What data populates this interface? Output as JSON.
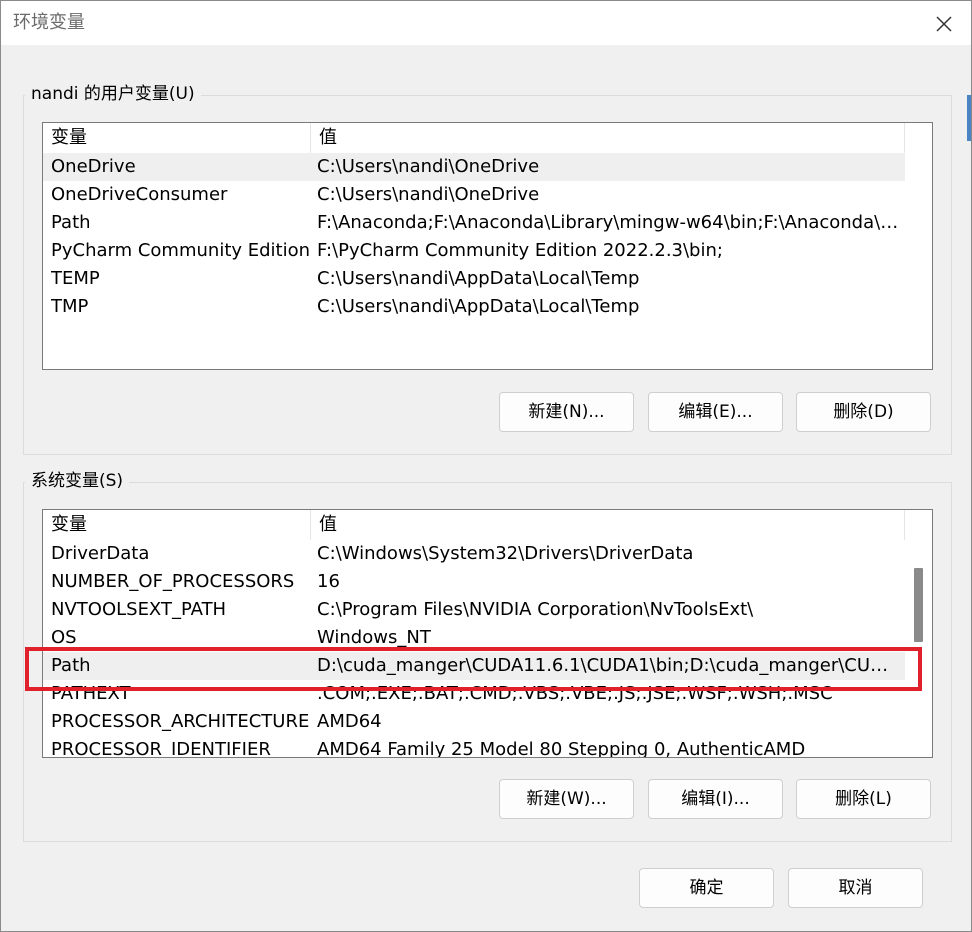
{
  "window": {
    "title": "环境变量",
    "close_glyph": "✕"
  },
  "user_vars": {
    "group_label": "nandi 的用户变量(U)",
    "col_variable": "变量",
    "col_value": "值",
    "rows": [
      {
        "name": "OneDrive",
        "value": "C:\\Users\\nandi\\OneDrive",
        "selected": true
      },
      {
        "name": "OneDriveConsumer",
        "value": "C:\\Users\\nandi\\OneDrive",
        "selected": false
      },
      {
        "name": "Path",
        "value": "F:\\Anaconda;F:\\Anaconda\\Library\\mingw-w64\\bin;F:\\Anaconda\\Li...",
        "selected": false
      },
      {
        "name": "PyCharm Community Edition",
        "value": "F:\\PyCharm Community Edition 2022.2.3\\bin;",
        "selected": false
      },
      {
        "name": "TEMP",
        "value": "C:\\Users\\nandi\\AppData\\Local\\Temp",
        "selected": false
      },
      {
        "name": "TMP",
        "value": "C:\\Users\\nandi\\AppData\\Local\\Temp",
        "selected": false
      }
    ],
    "buttons": {
      "new": "新建(N)...",
      "edit": "编辑(E)...",
      "delete": "删除(D)"
    }
  },
  "system_vars": {
    "group_label": "系统变量(S)",
    "col_variable": "变量",
    "col_value": "值",
    "rows": [
      {
        "name": "DriverData",
        "value": "C:\\Windows\\System32\\Drivers\\DriverData",
        "selected": false
      },
      {
        "name": "NUMBER_OF_PROCESSORS",
        "value": "16",
        "selected": false
      },
      {
        "name": "NVTOOLSEXT_PATH",
        "value": "C:\\Program Files\\NVIDIA Corporation\\NvToolsExt\\",
        "selected": false
      },
      {
        "name": "OS",
        "value": "Windows_NT",
        "selected": false
      },
      {
        "name": "Path",
        "value": "D:\\cuda_manger\\CUDA11.6.1\\CUDA1\\bin;D:\\cuda_manger\\CUDA...",
        "selected": true
      },
      {
        "name": "PATHEXT",
        "value": ".COM;.EXE;.BAT;.CMD;.VBS;.VBE;.JS;.JSE;.WSF;.WSH;.MSC",
        "selected": false
      },
      {
        "name": "PROCESSOR_ARCHITECTURE",
        "value": "AMD64",
        "selected": false
      },
      {
        "name": "PROCESSOR_IDENTIFIER",
        "value": "AMD64 Family 25 Model 80 Stepping 0, AuthenticAMD",
        "selected": false
      }
    ],
    "buttons": {
      "new": "新建(W)...",
      "edit": "编辑(I)...",
      "delete": "删除(L)"
    },
    "annotation_color": "#e0202a"
  },
  "footer": {
    "ok": "确定",
    "cancel": "取消"
  },
  "colors": {
    "window_bg": "#f0f0f0",
    "selected_row": "#efefef",
    "highlight": "#e0202a"
  }
}
